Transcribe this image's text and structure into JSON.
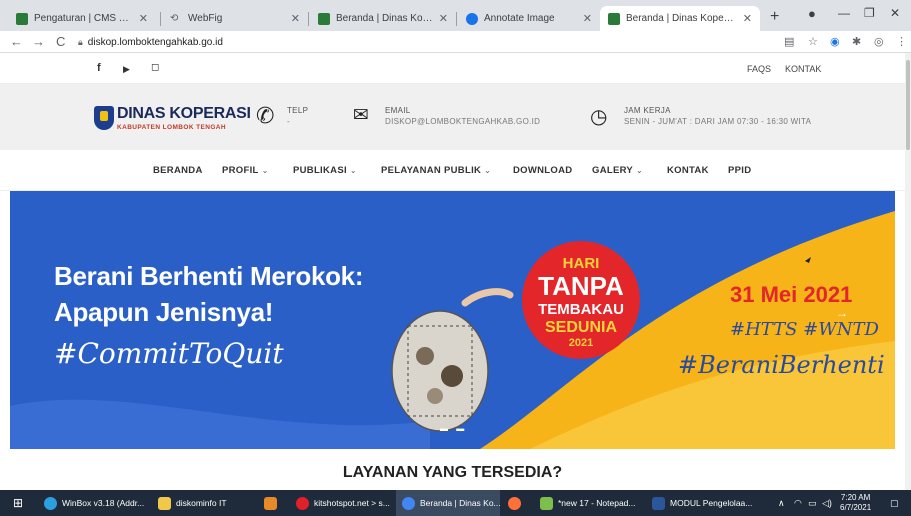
{
  "browser": {
    "tabs": [
      {
        "title": "Pengaturan | CMS Tastura",
        "active": false
      },
      {
        "title": "WebFig",
        "active": false
      },
      {
        "title": "Beranda | Dinas Koperasi dan",
        "active": false
      },
      {
        "title": "Annotate Image",
        "active": false
      },
      {
        "title": "Beranda | Dinas Koperasi dan",
        "active": true
      }
    ],
    "url": "diskop.lomboktengahkab.go.id"
  },
  "site": {
    "topbar": {
      "faqs": "FAQS",
      "kontak": "KONTAK"
    },
    "logo": {
      "title": "DINAS KOPERASI",
      "subtitle": "KABUPATEN LOMBOK TENGAH"
    },
    "info": {
      "telp_label": "TELP",
      "telp_value": "-",
      "email_label": "EMAIL",
      "email_value": "DISKOP@LOMBOKTENGAHKAB.GO.ID",
      "jam_label": "JAM KERJA",
      "jam_value": "SENIN - JUM'AT : DARI JAM 07:30 - 16:30 WITA"
    },
    "nav": [
      "BERANDA",
      "PROFIL",
      "PUBLIKASI",
      "PELAYANAN PUBLIK",
      "DOWNLOAD",
      "GALERY",
      "KONTAK",
      "PPID"
    ],
    "banner": {
      "line1": "Berani Berhenti Merokok:",
      "line2": "Apapun Jenisnya!",
      "line3": "#CommitToQuit",
      "badge1": "HARI",
      "badge2": "TANPA",
      "badge3": "TEMBAKAU",
      "badge4": "SEDUNIA",
      "badge5": "2021",
      "date": "31 Mei 2021",
      "hash1": "#HTTS #WNTD",
      "hash2": "#BeraniBerhenti"
    },
    "section_title": "LAYANAN YANG TERSEDIA?"
  },
  "taskbar": {
    "items": [
      {
        "label": "WinBox v3.18 (Addr..."
      },
      {
        "label": "diskominfo IT"
      },
      {
        "label": ""
      },
      {
        "label": "kitshotspot.net > s..."
      },
      {
        "label": "Beranda | Dinas Ko..."
      },
      {
        "label": ""
      },
      {
        "label": "*new 17 - Notepad..."
      },
      {
        "label": "MODUL Pengelolaa..."
      }
    ],
    "time": "7:20 AM",
    "date": "6/7/2021"
  }
}
